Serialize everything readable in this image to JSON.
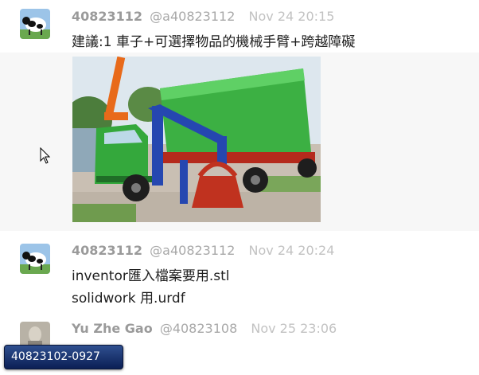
{
  "messages": [
    {
      "user": "40823112",
      "handle": "@a40823112",
      "time": "Nov 24 20:15",
      "lines": [
        "建議:1 車子+可選擇物品的機械手臂+跨越障礙"
      ],
      "image_alt": "green truck with blue crane arm and red grab bucket"
    },
    {
      "user": "40823112",
      "handle": "@a40823112",
      "time": "Nov 24 20:24",
      "lines": [
        "inventor匯入檔案要用.stl",
        "solidwork 用.urdf"
      ]
    },
    {
      "user": "Yu Zhe Gao",
      "handle": "@40823108",
      "time": "Nov 25 23:06",
      "lines": []
    }
  ],
  "tooltip": {
    "label": "40823102-0927"
  },
  "colors": {
    "hover_bg": "#f7f7f7",
    "tooltip_bg": "#1a3370"
  }
}
